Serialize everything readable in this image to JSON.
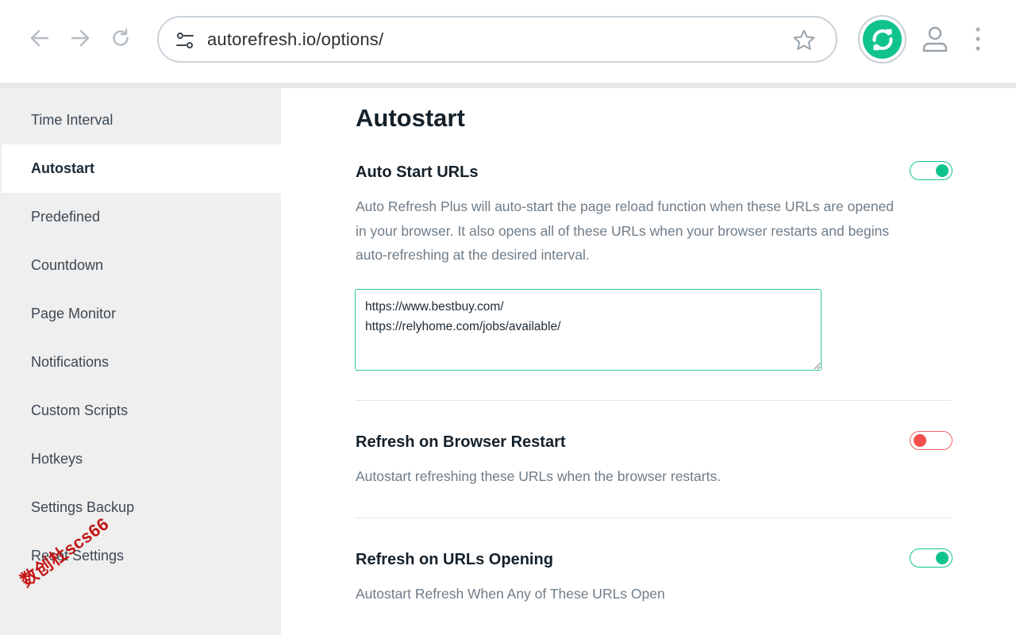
{
  "browser": {
    "url": "autorefresh.io/options/",
    "icons": {
      "back": "back-arrow-icon",
      "forward": "forward-arrow-icon",
      "reload": "reload-icon",
      "site_settings": "tune-icon",
      "bookmark": "star-icon",
      "extension": "auto-refresh-extension-icon",
      "profile": "profile-icon",
      "menu": "more-vertical-icon"
    },
    "colors": {
      "extension_green": "#10c38d"
    }
  },
  "sidebar": {
    "items": [
      {
        "label": "Time Interval",
        "active": false
      },
      {
        "label": "Autostart",
        "active": true
      },
      {
        "label": "Predefined",
        "active": false
      },
      {
        "label": "Countdown",
        "active": false
      },
      {
        "label": "Page Monitor",
        "active": false
      },
      {
        "label": "Notifications",
        "active": false
      },
      {
        "label": "Custom Scripts",
        "active": false
      },
      {
        "label": "Hotkeys",
        "active": false
      },
      {
        "label": "Settings Backup",
        "active": false
      },
      {
        "label": "Reset Settings",
        "active": false
      }
    ]
  },
  "main": {
    "title": "Autostart",
    "settings": [
      {
        "title": "Auto Start URLs",
        "description": "Auto Refresh Plus will auto-start the page reload function when these URLs are opened in your browser. It also opens all of these URLs when your browser restarts and begins auto-refreshing at the desired interval.",
        "enabled": true,
        "urls": "https://www.bestbuy.com/\nhttps://relyhome.com/jobs/available/"
      },
      {
        "title": "Refresh on Browser Restart",
        "description": "Autostart refreshing these URLs when the browser restarts.",
        "enabled": false
      },
      {
        "title": "Refresh on URLs Opening",
        "description": "Autostart Refresh When Any of These URLs Open",
        "enabled": true
      }
    ],
    "colors": {
      "toggle_on": "#10c38d",
      "toggle_off": "#f24e4e"
    }
  },
  "watermark": "数创杜scs66"
}
